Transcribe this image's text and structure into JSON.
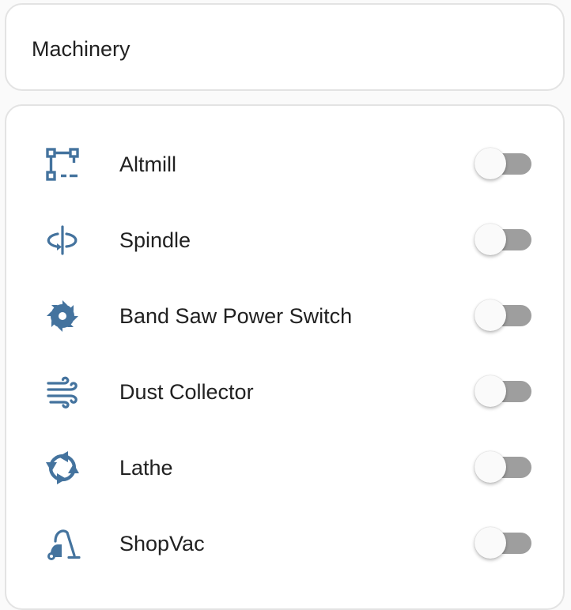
{
  "header": {
    "title": "Machinery"
  },
  "colors": {
    "icon": "#44739e",
    "track_off": "#9e9e9e",
    "thumb": "#fafafa"
  },
  "switches": [
    {
      "label": "Altmill",
      "icon": "vector-square-icon",
      "state": "off"
    },
    {
      "label": "Spindle",
      "icon": "axis-rotate-icon",
      "state": "off"
    },
    {
      "label": "Band Saw Power Switch",
      "icon": "saw-blade-icon",
      "state": "off"
    },
    {
      "label": "Dust Collector",
      "icon": "weather-windy-icon",
      "state": "off"
    },
    {
      "label": "Lathe",
      "icon": "rotate-arrows-icon",
      "state": "off"
    },
    {
      "label": "ShopVac",
      "icon": "vacuum-cleaner-icon",
      "state": "off"
    }
  ]
}
